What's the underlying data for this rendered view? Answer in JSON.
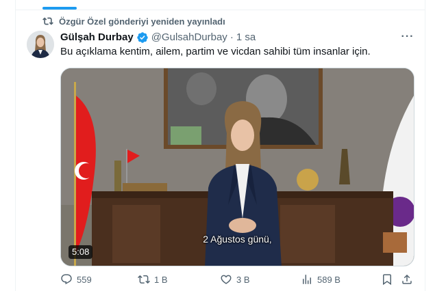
{
  "repost": {
    "label": "Özgür Özel gönderiyi yeniden yayınladı",
    "icon": "repost-icon"
  },
  "tweet": {
    "author_name": "Gülşah Durbay",
    "verified_icon": "verified-badge-icon",
    "handle": "@GulsahDurbay",
    "separator": "·",
    "time": "1 sa",
    "text": "Bu açıklama kentim, ailem, partim ve vicdan sahibi tüm insanlar için.",
    "more_icon": "more-options-icon"
  },
  "video": {
    "subtitle": "2 Ağustos günü,",
    "duration": "5:08"
  },
  "actions": {
    "reply_count": "559",
    "repost_count": "1 B",
    "like_count": "3 B",
    "view_count": "589 B"
  },
  "colors": {
    "accent": "#1d9bf0",
    "secondary_text": "#536471",
    "primary_text": "#0f1419",
    "border": "#eff3f4"
  }
}
